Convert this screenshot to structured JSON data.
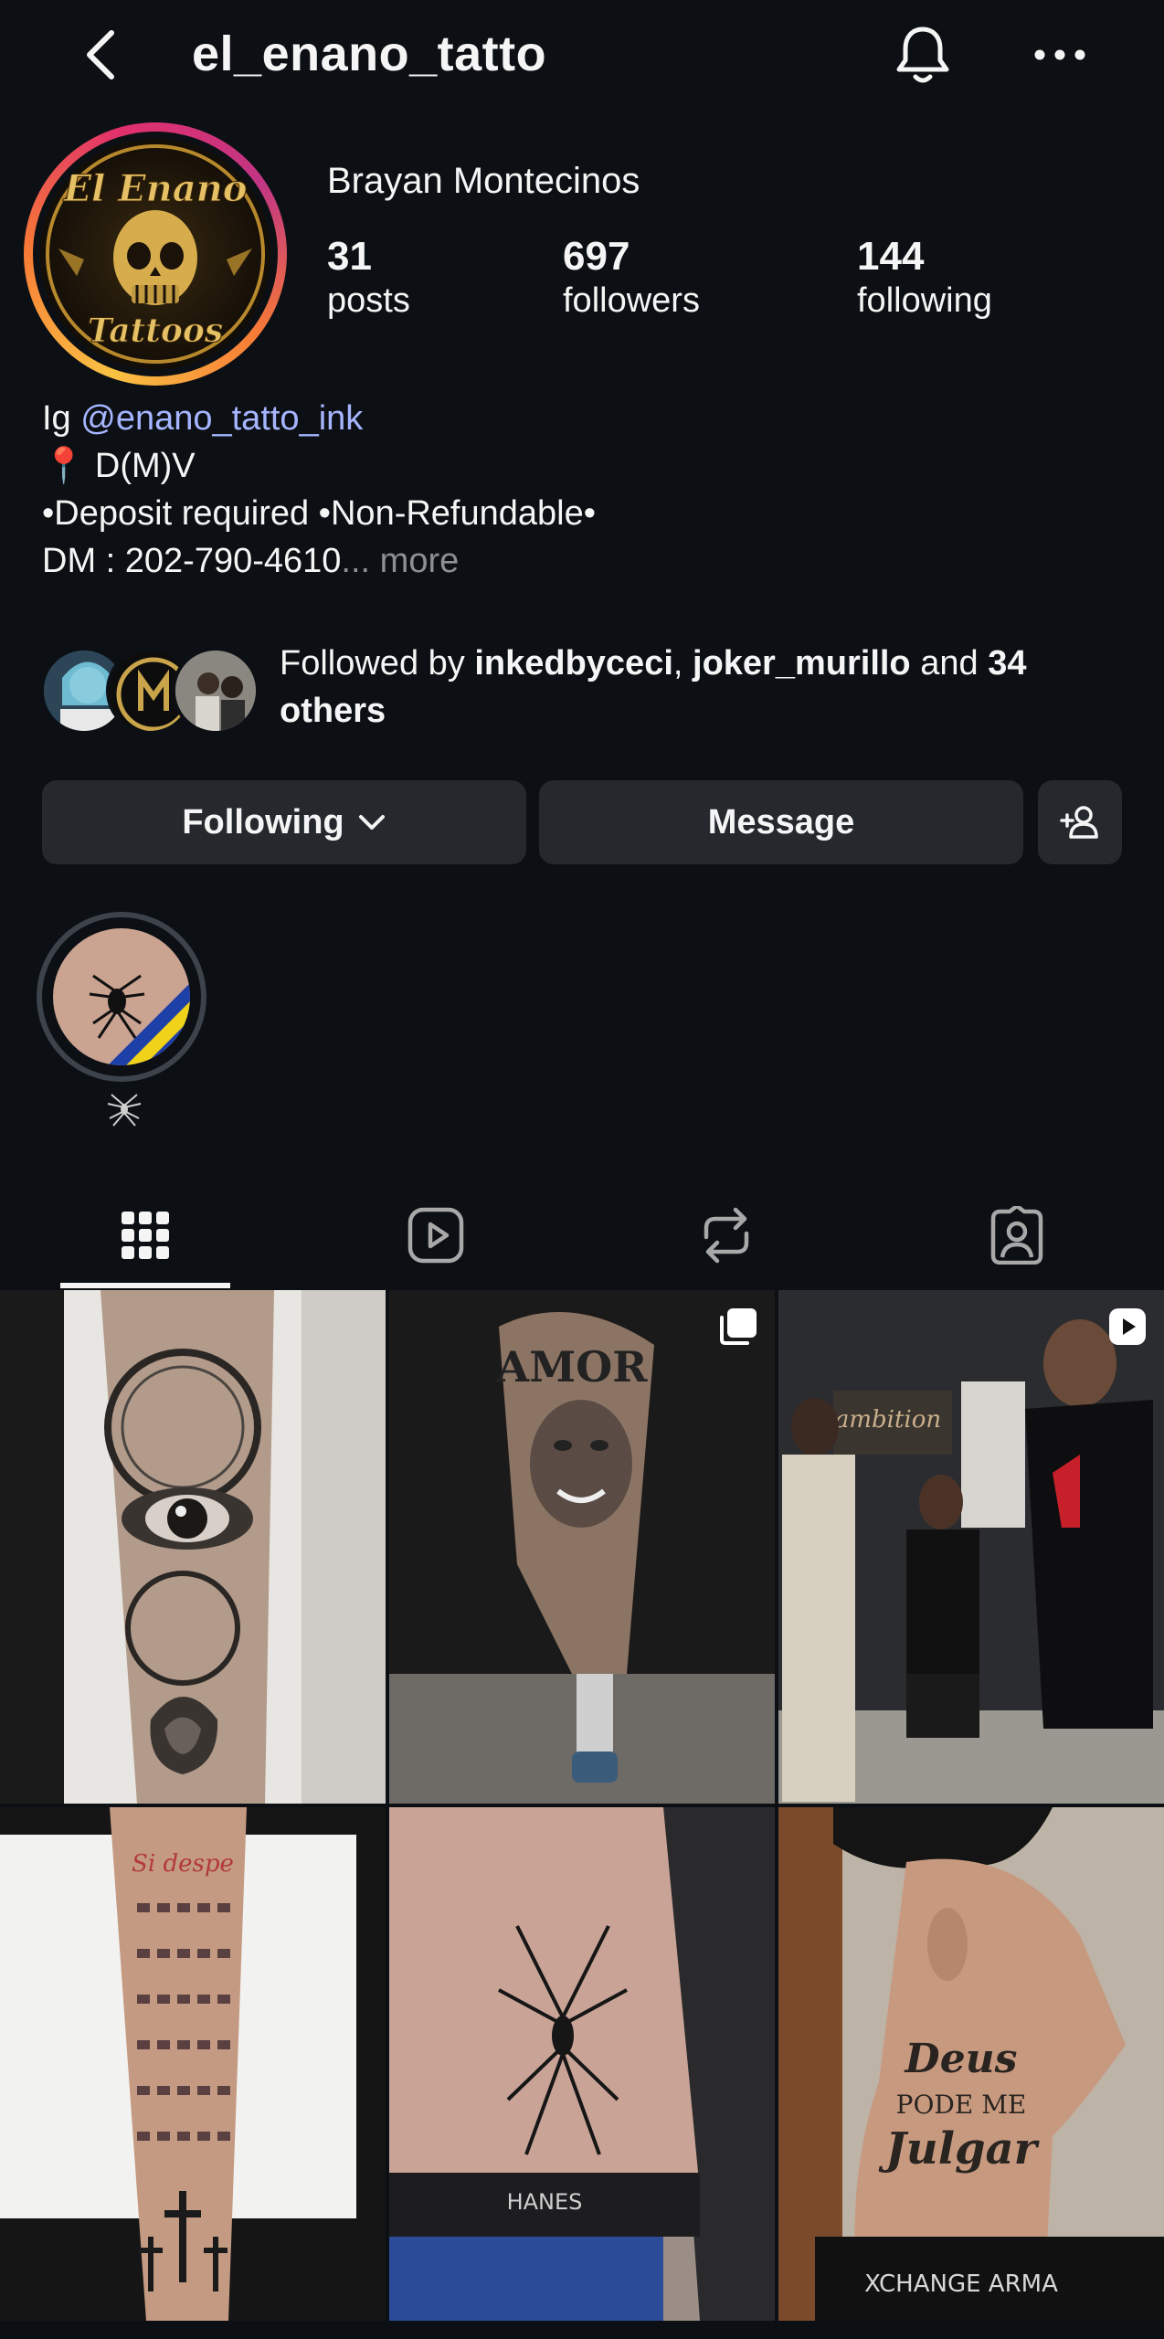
{
  "header": {
    "username": "el_enano_tatto"
  },
  "profile": {
    "display_name": "Brayan Montecinos",
    "logo_text_top": "El Enano",
    "logo_text_bottom": "Tattoos",
    "stats": [
      {
        "value": "31",
        "label": "posts"
      },
      {
        "value": "697",
        "label": "followers"
      },
      {
        "value": "144",
        "label": "following"
      }
    ],
    "bio": {
      "prefix": "Ig ",
      "handle": "@enano_tatto_ink",
      "location_pin": "📍",
      "location": " D(M)V",
      "line3": "•Deposit required •Non-Refundable•",
      "line4": " DM : 202-790-4610",
      "ellipsis": "...",
      "more": " more"
    }
  },
  "followed_by": {
    "prefix": "Followed by ",
    "user1": "inkedbyceci",
    "sep": ", ",
    "user2": "joker_murillo",
    "and": " and ",
    "count": "34",
    "line2": "others"
  },
  "actions": {
    "following_label": "Following",
    "message_label": "Message"
  },
  "highlights": [
    {
      "label_icon": "spider-icon"
    }
  ],
  "tabs": [
    "grid-icon",
    "reels-icon",
    "reposts-icon",
    "tagged-icon"
  ],
  "grid": {
    "post2_overlay_text": "AMOR",
    "post3_sign_text": "ambition",
    "post5_brand_text": "HANES",
    "post6_text_1": "Deus",
    "post6_text_2": "PODE ME",
    "post6_text_3": "Julgar",
    "post4_text": "Si despe",
    "post6_shirt_text": "XCHANGE  ARMA"
  },
  "colors": {
    "background": "#0c1014",
    "button": "#25292e",
    "link": "#a6b5ff",
    "muted": "#8e8e93"
  }
}
